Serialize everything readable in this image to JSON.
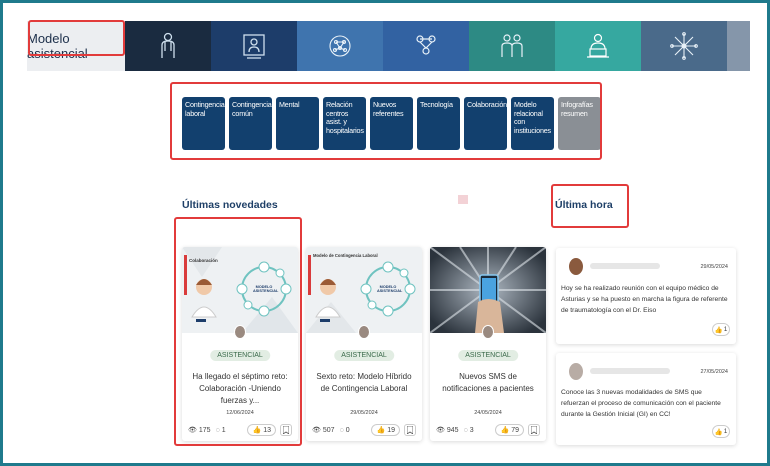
{
  "header": {
    "title": "Modelo asistencial",
    "segments": [
      {
        "icon": "doctor-figure-icon",
        "color": "#1a2b40"
      },
      {
        "icon": "presenter-screen-icon",
        "color": "#1d3d6a"
      },
      {
        "icon": "neural-network-icon",
        "color": "#3f74ae"
      },
      {
        "icon": "team-network-icon",
        "color": "#3262a2"
      },
      {
        "icon": "doctor-pair-icon",
        "color": "#2d8a84"
      },
      {
        "icon": "doctor-laptop-icon",
        "color": "#36a8a0"
      },
      {
        "icon": "star-network-icon",
        "color": "#4a6a8a"
      },
      {
        "icon": "",
        "color": "#8596aa"
      }
    ]
  },
  "categories": [
    {
      "label": "Contingencia laboral",
      "style": "blue"
    },
    {
      "label": "Contingencia común",
      "style": "blue"
    },
    {
      "label": "Mental",
      "style": "blue"
    },
    {
      "label": "Relación centros asist. y hospitalarios",
      "style": "blue"
    },
    {
      "label": "Nuevos referentes",
      "style": "blue"
    },
    {
      "label": "Tecnología",
      "style": "blue"
    },
    {
      "label": "Colaboración",
      "style": "blue"
    },
    {
      "label": "Modelo relacional con instituciones",
      "style": "blue"
    },
    {
      "label": "Infografías resumen",
      "style": "gray"
    }
  ],
  "news": {
    "title": "Últimas novedades",
    "cards": [
      {
        "image_label": "Colaboración",
        "image_caption": "MODELO ASISTENCIAL",
        "badge": "ASISTENCIAL",
        "title": "Ha llegado el séptimo reto: Colaboración -Uniendo fuerzas y...",
        "date": "12/06/2024",
        "views": "175",
        "comments": "1",
        "likes": "13"
      },
      {
        "image_label": "Modelo de Contingencia Laboral",
        "image_caption": "MODELO ASISTENCIAL",
        "badge": "ASISTENCIAL",
        "title": "Sexto reto: Modelo Híbrido de Contingencia Laboral",
        "date": "29/05/2024",
        "views": "507",
        "comments": "0",
        "likes": "19"
      },
      {
        "image_label": "",
        "image_caption": "",
        "badge": "ASISTENCIAL",
        "title": "Nuevos SMS de notificaciones a pacientes",
        "date": "24/05/2024",
        "views": "945",
        "comments": "3",
        "likes": "79"
      }
    ]
  },
  "latest": {
    "title": "Última hora",
    "posts": [
      {
        "date": "29/05/2024",
        "text": "Hoy se ha realizado reunión con el equipo médico de Asturias y se ha puesto en marcha la figura de referente de traumatología con el Dr. Eiso",
        "likes": "1"
      },
      {
        "date": "27/05/2024",
        "text": "Conoce las 3 nuevas modalidades de SMS que refuerzan el proceso de comunicación con el paciente durante la Gestión Inicial (GI) en CC!",
        "likes": "1"
      }
    ]
  }
}
